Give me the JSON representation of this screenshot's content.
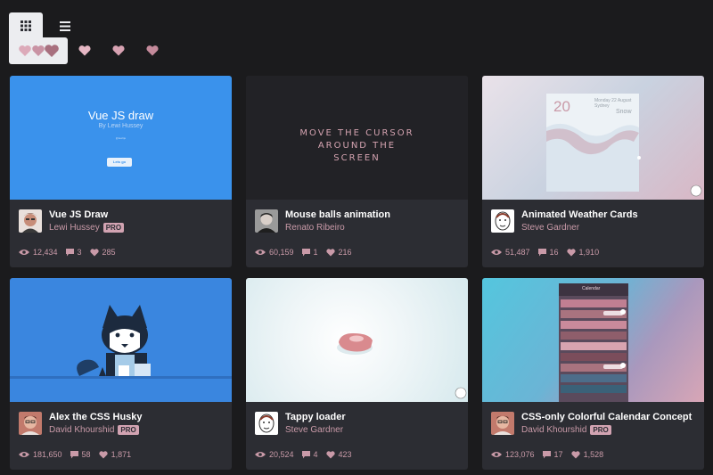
{
  "toolbar": {
    "grid_view_icon": "grid-icon",
    "list_view_icon": "list-icon"
  },
  "filters": {
    "all_icon": "hearts-group-icon",
    "heart_colors": [
      "#d9a0b1",
      "#c98da0",
      "#b77a8d"
    ]
  },
  "colors": {
    "background": "#1b1b1d",
    "card": "#2c2d33",
    "accent": "#c99aa8",
    "pro_badge": "#d2a3b2"
  },
  "cards": [
    {
      "title": "Vue JS Draw",
      "author": "Lewi Hussey",
      "pro": "PRO",
      "views": "12,434",
      "comments": "3",
      "likes": "285",
      "preview": {
        "heading": "Vue JS draw",
        "subheading": "By Lewi Hussey",
        "small": "@lewitje",
        "button": "Lets go"
      }
    },
    {
      "title": "Mouse balls animation",
      "author": "Renato Ribeiro",
      "pro": "",
      "views": "60,159",
      "comments": "1",
      "likes": "216",
      "preview": {
        "line1": "MOVE THE CURSOR",
        "line2": "AROUND THE",
        "line3": "SCREEN"
      }
    },
    {
      "title": "Animated Weather Cards",
      "author": "Steve Gardner",
      "pro": "",
      "views": "51,487",
      "comments": "16",
      "likes": "1,910",
      "preview": {
        "temp": "20",
        "date": "Monday 22 August",
        "place": "Sydney",
        "condition": "Snow"
      }
    },
    {
      "title": "Alex the CSS Husky",
      "author": "David Khourshid",
      "pro": "PRO",
      "views": "181,650",
      "comments": "58",
      "likes": "1,871",
      "preview": {}
    },
    {
      "title": "Tappy loader",
      "author": "Steve Gardner",
      "pro": "",
      "views": "20,524",
      "comments": "4",
      "likes": "423",
      "preview": {}
    },
    {
      "title": "CSS-only Colorful Calendar Concept",
      "author": "David Khourshid",
      "pro": "PRO",
      "views": "123,076",
      "comments": "17",
      "likes": "1,528",
      "preview": {
        "header": "Calendar"
      }
    }
  ]
}
